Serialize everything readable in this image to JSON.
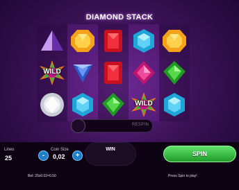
{
  "game": {
    "title": "DIAMOND STACK"
  },
  "reels": [
    [
      {
        "name": "purple-pyramid-gem"
      },
      {
        "name": "wild-symbol",
        "text": "WILD"
      },
      {
        "name": "white-diamond-gem"
      }
    ],
    [
      {
        "name": "orange-gem"
      },
      {
        "name": "blue-triangle-gem"
      },
      {
        "name": "blue-gem"
      }
    ],
    [
      {
        "name": "red-gem"
      },
      {
        "name": "red-gem"
      },
      {
        "name": "green-gem"
      }
    ],
    [
      {
        "name": "blue-gem"
      },
      {
        "name": "pink-diamond-gem"
      },
      {
        "name": "wild-symbol",
        "text": "WILD"
      }
    ],
    [
      {
        "name": "orange-gem"
      },
      {
        "name": "green-gem"
      },
      {
        "name": "blue-gem"
      }
    ]
  ],
  "respin": {
    "label": "RESPIN"
  },
  "controls": {
    "lines_label": "Lines",
    "lines_value": "25",
    "coin_size_label": "Coin Size",
    "coin_size_value": "0,02",
    "minus_label": "-",
    "plus_label": "+",
    "win_label": "WIN",
    "spin_label": "SPIN"
  },
  "footer": {
    "bet_text": "Bet: 25x0.02=0.50",
    "hint_text": "Press Spin to play!"
  }
}
